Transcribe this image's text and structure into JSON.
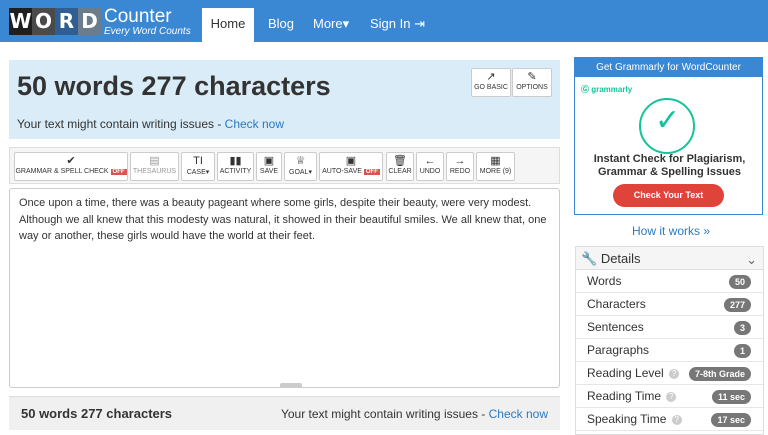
{
  "logo": {
    "letters": [
      "W",
      "O",
      "R",
      "D"
    ],
    "main": "Counter",
    "sub": "Every Word Counts"
  },
  "nav": {
    "home": "Home",
    "blog": "Blog",
    "more": "More",
    "more_caret": "▾",
    "signin": "Sign In",
    "signin_icon": "⇥"
  },
  "header": {
    "counts": "50 words 277 characters",
    "issues_text": "Your text might contain writing issues - ",
    "check_now": "Check now",
    "go_basic": "GO BASIC",
    "go_basic_icon": "↗",
    "options": "OPTIONS",
    "options_icon": "✎"
  },
  "toolbar": {
    "grammar": "GRAMMAR & SPELL CHECK",
    "off": "OFF",
    "thesaurus": "THESAURUS",
    "case": "CASE",
    "activity": "ACTIVITY",
    "save": "SAVE",
    "goal": "GOAL",
    "autosave": "AUTO-SAVE",
    "clear": "CLEAR",
    "undo": "UNDO",
    "redo": "REDO",
    "more": "MORE (9)"
  },
  "editor": {
    "text": "Once upon a time, there was a beauty pageant where some girls, despite their beauty, were very modest. Although we all knew that this modesty was natural, it showed in their beautiful smiles. We all knew that, one way or another, these girls would have the world at their feet."
  },
  "footer": {
    "counts": "50 words 277 characters",
    "issues_text": "Your text might contain writing issues - ",
    "check_now": "Check now"
  },
  "ad": {
    "head": "Get Grammarly for WordCounter",
    "brand": "grammarly",
    "line1": "Instant Check for Plagiarism,",
    "line2": "Grammar & Spelling Issues",
    "button": "Check Your Text"
  },
  "how_it_works": "How it works »",
  "details": {
    "title": "Details",
    "rows": [
      {
        "label": "Words",
        "value": "50"
      },
      {
        "label": "Characters",
        "value": "277"
      },
      {
        "label": "Sentences",
        "value": "3"
      },
      {
        "label": "Paragraphs",
        "value": "1"
      },
      {
        "label": "Reading Level",
        "value": "7-8th Grade"
      },
      {
        "label": "Reading Time",
        "value": "11 sec"
      },
      {
        "label": "Speaking Time",
        "value": "17 sec"
      }
    ]
  },
  "colors": {
    "nav": "#3a87d3",
    "header_bg": "#d9ecf7",
    "link": "#2a7ac0",
    "grammarly": "#15c39a",
    "cta": "#e0433a"
  }
}
